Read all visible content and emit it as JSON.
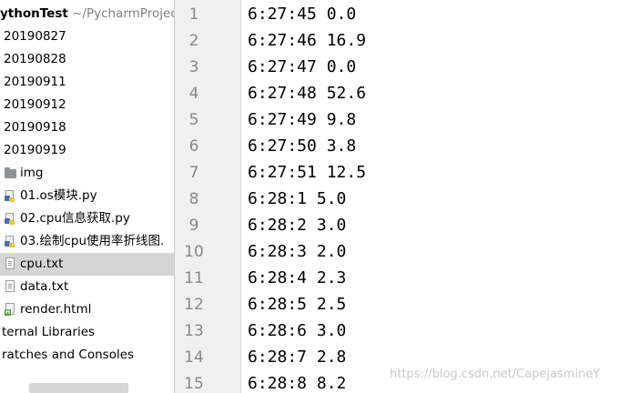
{
  "project_tree": {
    "root_name": "ythonTest",
    "root_path": " ~/PycharmProjects",
    "items": [
      {
        "label": "20190827"
      },
      {
        "label": "20190828"
      },
      {
        "label": "20190911"
      },
      {
        "label": "20190912"
      },
      {
        "label": "20190918"
      },
      {
        "label": "20190919"
      },
      {
        "label": "img"
      },
      {
        "label": "01.os模块.py"
      },
      {
        "label": "02.cpu信息获取.py"
      },
      {
        "label": "03.绘制cpu使用率折线图."
      },
      {
        "label": "cpu.txt"
      },
      {
        "label": "data.txt"
      },
      {
        "label": "render.html"
      },
      {
        "label": "ternal Libraries"
      },
      {
        "label": "ratches and Consoles"
      }
    ],
    "selected_item": "cpu.txt"
  },
  "editor": {
    "line_numbers": [
      "1",
      "2",
      "3",
      "4",
      "5",
      "6",
      "7",
      "8",
      "9",
      "10",
      "11",
      "12",
      "13",
      "14",
      "15"
    ],
    "lines": [
      "6:27:45 0.0",
      "6:27:46 16.9",
      "6:27:47 0.0",
      "6:27:48 52.6",
      "6:27:49 9.8",
      "6:27:50 3.8",
      "6:27:51 12.5",
      "6:28:1 5.0",
      "6:28:2 3.0",
      "6:28:3 2.0",
      "6:28:4 2.3",
      "6:28:5 2.5",
      "6:28:6 3.0",
      "6:28:7 2.8",
      "6:28:8 8.2"
    ]
  },
  "watermark": "https://blog.csdn.net/CapejasmineY",
  "icons": {
    "folder": "folder-icon",
    "python_file": "python-file-icon",
    "text_file": "text-file-icon",
    "html_file": "html-file-icon"
  },
  "colors": {
    "selection": "#d5d5d5",
    "gutter": "#f0f0f0",
    "line_number": "#888888",
    "python_blue": "#3f72af",
    "python_yellow": "#f2c230"
  }
}
